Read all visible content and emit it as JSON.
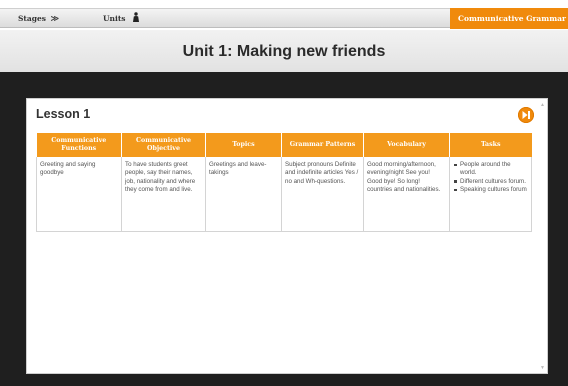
{
  "nav": {
    "stages_label": "Stages",
    "stages_chevron": "≫",
    "units_label": "Units",
    "course_label": "Communicative Grammar English"
  },
  "page": {
    "title": "Unit 1: Making new friends"
  },
  "lesson": {
    "title": "Lesson 1",
    "table": {
      "headers": [
        "Communicative Functions",
        "Communicative Objective",
        "Topics",
        "Grammar Patterns",
        "Vocabulary",
        "Tasks"
      ],
      "row": {
        "functions": "Greeting and saying goodbye",
        "objective": "To have students greet people, say their names, job, nationality and where they come from and live.",
        "topics": "Greetings and leave-takings",
        "grammar": "Subject pronouns Definite and indefinite articles Yes / no and Wh-questions.",
        "vocabulary": "Good morning/afternoon, evening/night See you! Good bye! So long! countries and nationalities.",
        "tasks": [
          "People around the world.",
          "Different cultures forum.",
          "Speaking cultures forum"
        ]
      }
    }
  },
  "icons": {
    "next": "next-arrow-icon",
    "units": "person-icon"
  },
  "colors": {
    "accent": "#f08a0c",
    "header_bg": "#f39a1c",
    "stage_bg": "#1f1f1f"
  }
}
